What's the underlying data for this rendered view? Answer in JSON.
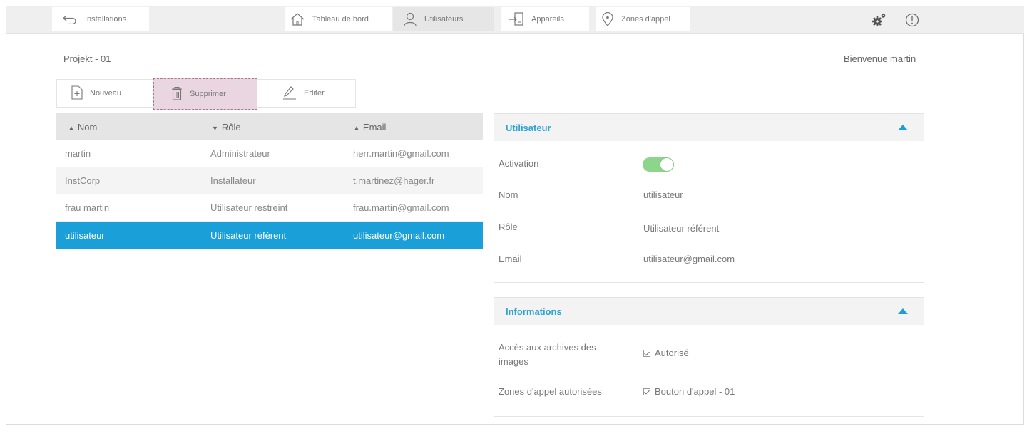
{
  "topbar": {
    "back_label": "Installations",
    "nav": [
      {
        "label": "Tableau de bord",
        "icon": "home-icon"
      },
      {
        "label": "Utilisateurs",
        "icon": "user-icon",
        "active": true
      },
      {
        "label": "Appareils",
        "icon": "device-icon"
      },
      {
        "label": "Zones d'appel",
        "icon": "location-pin-icon"
      }
    ],
    "settings_icon": "gears-icon",
    "info_icon": "info-icon"
  },
  "header": {
    "project": "Projekt - 01",
    "welcome": "Bienvenue martin"
  },
  "toolbar": {
    "new_label": "Nouveau",
    "delete_label": "Supprimer",
    "edit_label": "Editer"
  },
  "table": {
    "headers": [
      "Nom",
      "Rôle",
      "Email"
    ],
    "sort_glyphs": [
      "⬍",
      "▼",
      "⬍"
    ],
    "rows": [
      {
        "nom": "martin",
        "role": "Administrateur",
        "email": "herr.martin@gmail.com"
      },
      {
        "nom": "InstCorp",
        "role": "Installateur",
        "email": "t.martinez@hager.fr"
      },
      {
        "nom": "frau martin",
        "role": "Utilisateur restreint",
        "email": "frau.martin@gmail.com"
      },
      {
        "nom": "utilisateur",
        "role": "Utilisateur référent",
        "email": "utilisateur@gmail.com",
        "selected": true
      }
    ]
  },
  "user_panel": {
    "title": "Utilisateur",
    "activation_label": "Activation",
    "activation_on": true,
    "nom_label": "Nom",
    "nom_value": "utilisateur",
    "role_label": "Rôle",
    "role_value": "Utilisateur référent",
    "email_label": "Email",
    "email_value": "utilisateur@gmail.com"
  },
  "info_panel": {
    "title": "Informations",
    "archives_label": "Accès aux archives des images",
    "archives_value": "Autorisé",
    "zones_label": "Zones d'appel autorisées",
    "zones_value": "Bouton d'appel - 01"
  },
  "colors": {
    "accent": "#1a9fd8",
    "panel_title": "#2fa3d3",
    "toggle_on": "#8dd58d",
    "delete_highlight": "#ead6e1"
  }
}
